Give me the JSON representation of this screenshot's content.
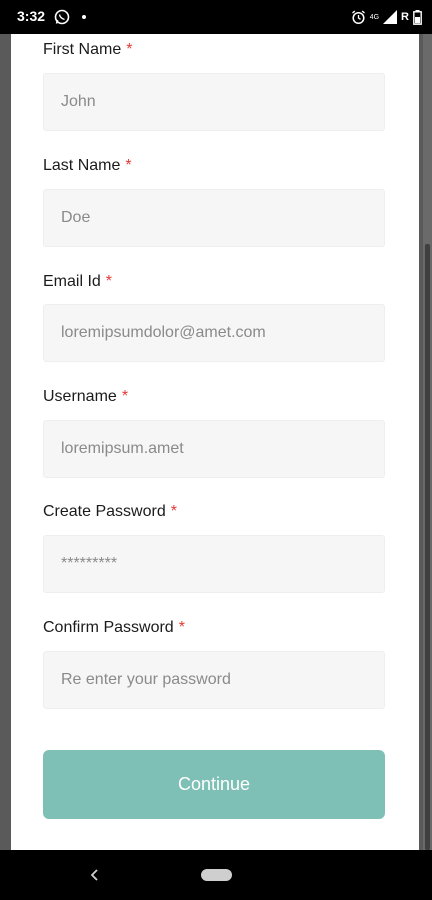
{
  "status_bar": {
    "time": "3:32",
    "network_label": "4G",
    "roaming_label": "R",
    "icons": [
      "whatsapp-icon",
      "alarm-icon",
      "signal-icon",
      "battery-icon"
    ]
  },
  "form": {
    "fields": [
      {
        "label": "First Name",
        "required_mark": "*",
        "value": "John",
        "placeholder": ""
      },
      {
        "label": "Last Name",
        "required_mark": "*",
        "value": "Doe",
        "placeholder": ""
      },
      {
        "label": "Email Id",
        "required_mark": "*",
        "value": "loremipsumdolor@amet.com",
        "placeholder": ""
      },
      {
        "label": "Username",
        "required_mark": "*",
        "value": "loremipsum.amet",
        "placeholder": ""
      },
      {
        "label": "Create Password",
        "required_mark": "*",
        "value": "*********",
        "placeholder": ""
      },
      {
        "label": "Confirm Password",
        "required_mark": "*",
        "value": "",
        "placeholder": "Re enter your password"
      }
    ],
    "continue_label": "Continue"
  },
  "colors": {
    "accent": "#7fc0b6",
    "required": "#e53935",
    "input_bg": "#f6f6f6"
  },
  "nav_icons": [
    "back-icon",
    "home-pill-icon"
  ]
}
